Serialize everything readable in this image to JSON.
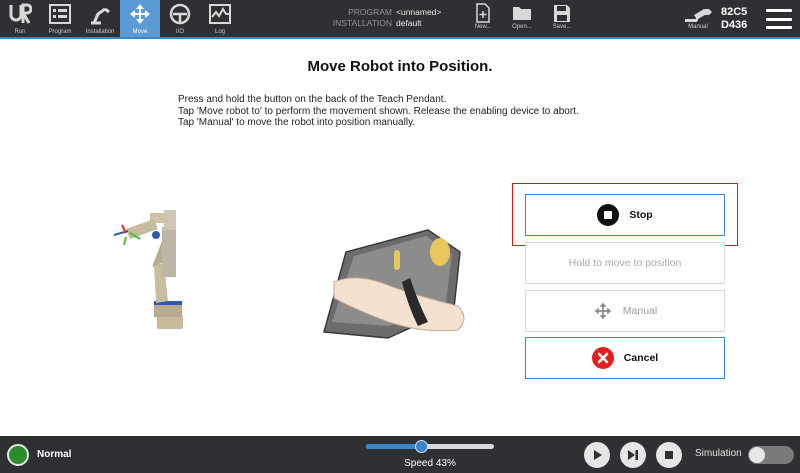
{
  "header": {
    "nav_tabs": [
      {
        "label": "Run",
        "icon": "ur-logo-icon"
      },
      {
        "label": "Program",
        "icon": "program-icon"
      },
      {
        "label": "Installation",
        "icon": "installation-icon"
      },
      {
        "label": "Move",
        "icon": "move-icon",
        "active": true
      },
      {
        "label": "I/O",
        "icon": "io-icon"
      },
      {
        "label": "Log",
        "icon": "log-icon"
      }
    ],
    "program_key": "PROGRAM",
    "program_value": "<unnamed>",
    "installation_key": "INSTALLATION",
    "installation_value": "default",
    "file_buttons": [
      {
        "label": "New...",
        "icon": "new-file-icon"
      },
      {
        "label": "Open...",
        "icon": "folder-icon"
      },
      {
        "label": "Save...",
        "icon": "save-icon"
      }
    ],
    "mode_label": "Manual",
    "robot_id_line1": "82C5",
    "robot_id_line2": "D436"
  },
  "main": {
    "title": "Move Robot into Position.",
    "instructions": [
      "Press and hold the button on the back of the Teach Pendant.",
      "Tap 'Move robot to' to perform the movement shown. Release the enabling device to abort.",
      "Tap 'Manual' to move the robot into position manually."
    ],
    "buttons": {
      "stop": "Stop",
      "hold": "Hold to move to position",
      "manual": "Manual",
      "cancel": "Cancel"
    }
  },
  "footer": {
    "status": "Normal",
    "speed_label": "Speed 43%",
    "speed_fraction": 0.43,
    "simulation_label": "Simulation",
    "simulation_on": false
  },
  "colors": {
    "header_bg": "#2f3033",
    "accent_blue": "#3a86c8",
    "active_tab": "#5b9bd5",
    "highlight_red": "#d11a1a",
    "cancel_red": "#e02020",
    "status_green": "#2b8c2b"
  }
}
